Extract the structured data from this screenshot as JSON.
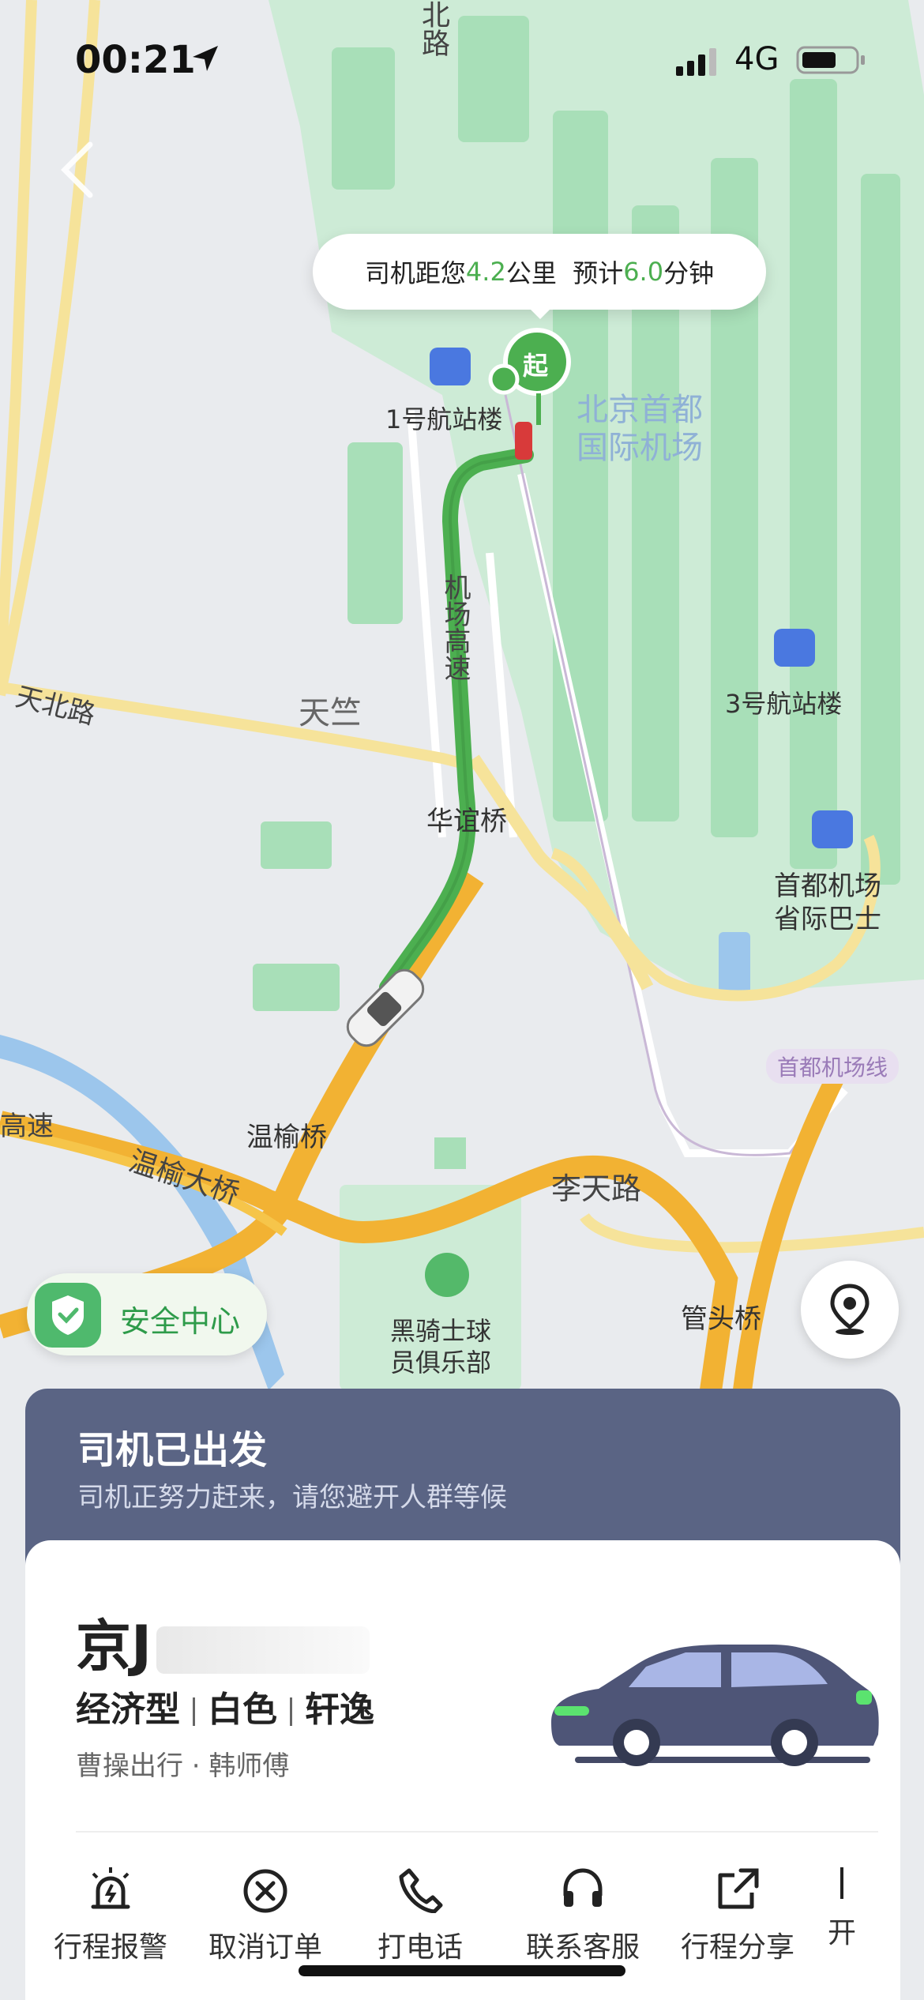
{
  "status_bar": {
    "time": "00:21",
    "network": "4G"
  },
  "eta_bubble": {
    "prefix": "司机距您",
    "distance": "4.2",
    "distance_unit": "公里",
    "mid": "预计",
    "time": "6.0",
    "time_unit": "分钟"
  },
  "map": {
    "pickup_marker": "起",
    "labels": {
      "bei_lu": "北路",
      "t1": "1号航站楼",
      "airport": "北京首都",
      "airport2": "国际机场",
      "expressway": "机场高速",
      "tianbei": "天北路",
      "tianzhu": "天竺",
      "t3": "3号航站楼",
      "huayi": "华谊桥",
      "bus": "首都机场",
      "bus2": "省际巴士",
      "airport_line": "首都机场线",
      "wenyu_bridge": "温榆桥",
      "wenyu_da": "温榆大桥",
      "gaosu": "高速",
      "litian": "李天路",
      "golf": "黑骑士球",
      "golf2": "员俱乐部",
      "guantou": "管头桥"
    }
  },
  "safety_center": {
    "label": "安全中心"
  },
  "status_panel": {
    "title": "司机已出发",
    "subtitle": "司机正努力赶来，请您避开人群等候"
  },
  "vehicle": {
    "plate_visible": "京J",
    "type": "经济型",
    "color": "白色",
    "model": "轩逸",
    "driver": "曹操出行 · 韩师傅"
  },
  "actions": [
    {
      "label": "行程报警",
      "icon": "alarm-icon"
    },
    {
      "label": "取消订单",
      "icon": "cancel-circle-icon"
    },
    {
      "label": "打电话",
      "icon": "phone-icon"
    },
    {
      "label": "联系客服",
      "icon": "headset-icon"
    },
    {
      "label": "行程分享",
      "icon": "share-icon"
    },
    {
      "label": "开",
      "icon": ""
    }
  ],
  "colors": {
    "route": "#4caf50",
    "accent_green": "#4caf50",
    "panel": "#5a6484",
    "road": "#f6c54a",
    "highway": "#f2b233"
  }
}
